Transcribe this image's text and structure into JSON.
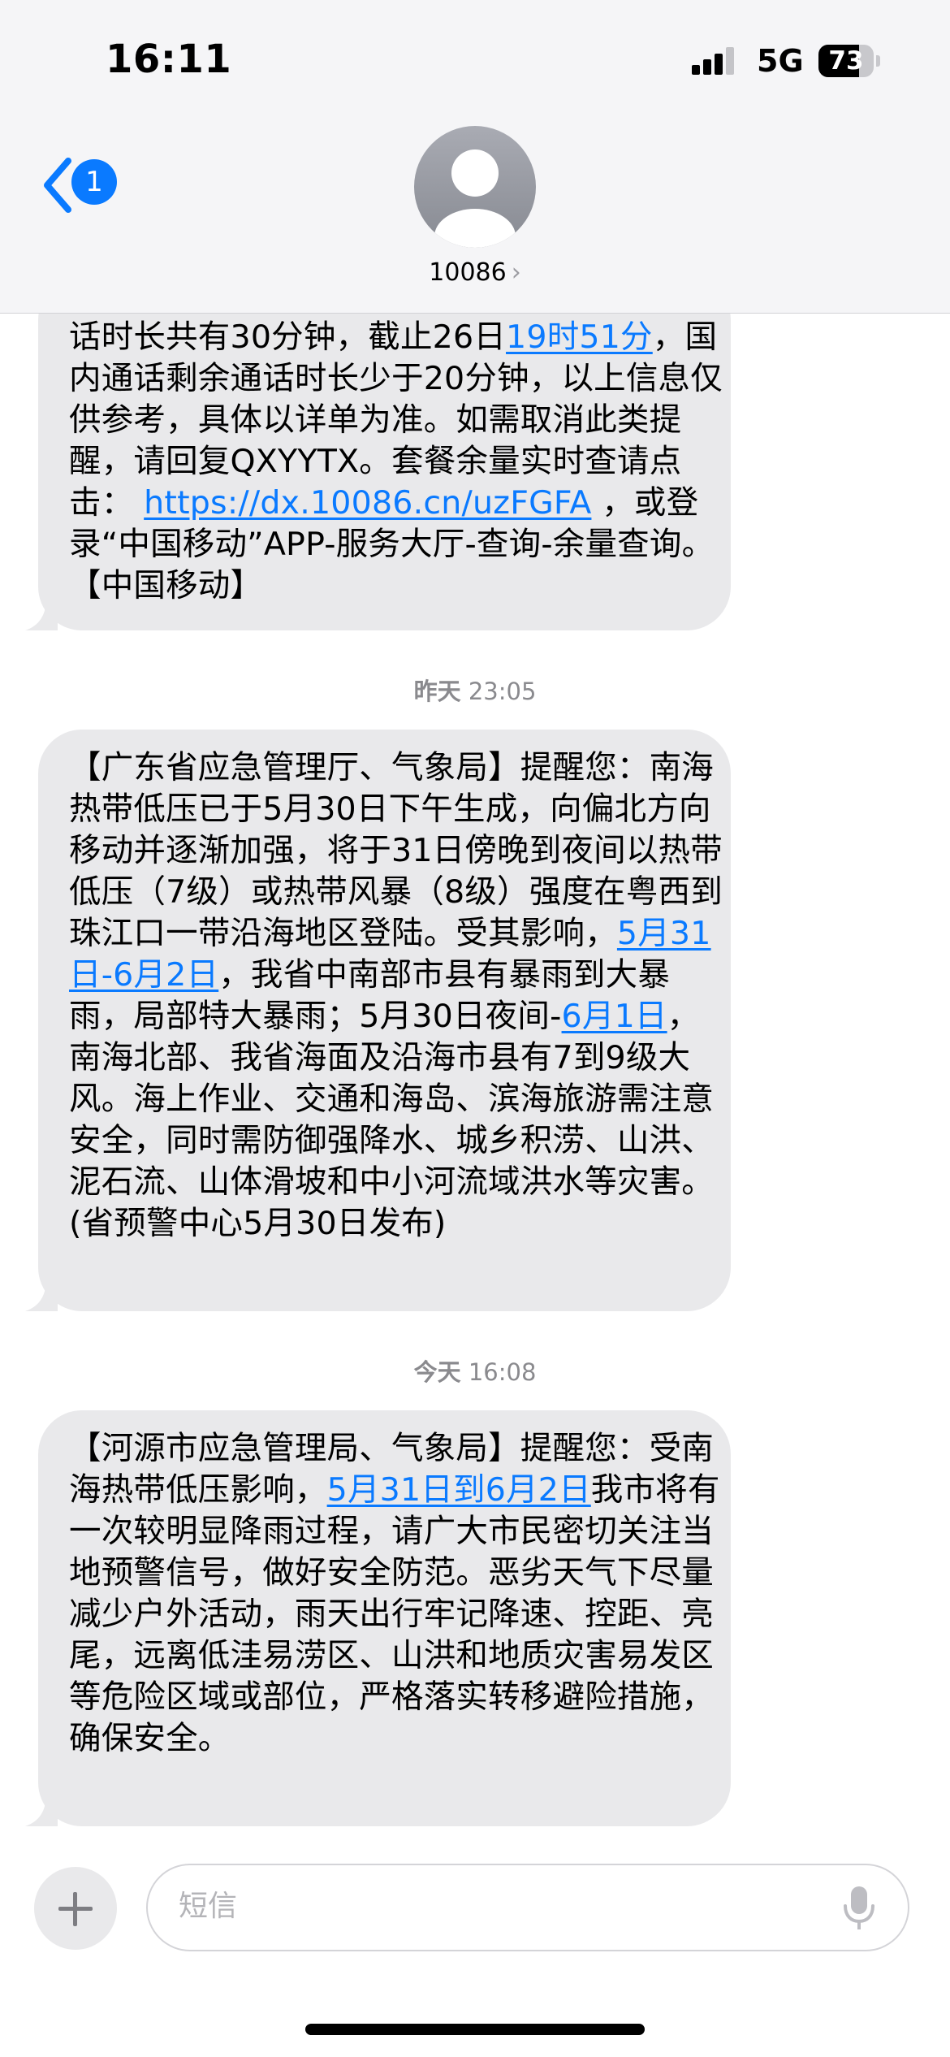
{
  "status_bar": {
    "time": "16:11",
    "network": "5G",
    "battery": "73"
  },
  "nav": {
    "back_count": "1",
    "contact_name": "10086",
    "contact_chevron": "›"
  },
  "thread": {
    "msg1": {
      "t1": "话时长共有30分钟，截止26日",
      "l1": "19时51分",
      "t2": "，国内通话剩余通话时长少于20分钟，以上信息仅供参考，具体以详单为准。如需取消此类提醒，请回复QXYYTX。套餐余量实时查请点击： ",
      "l2": "https://dx.10086.cn/uzFGFA",
      "t3": " ，或登录“中国移动”APP-服务大厅-查询-余量查询。【中国移动】"
    },
    "ts1": {
      "day": "昨天",
      "time": "23:05"
    },
    "msg2": {
      "t1": "【广东省应急管理厅、气象局】提醒您：南海热带低压已于5月30日下午生成，向偏北方向移动并逐渐加强，将于31日傍晚到夜间以热带低压（7级）或热带风暴（8级）强度在粤西到珠江口一带沿海地区登陆。受其影响，",
      "l1": "5月31日-6月2日",
      "t2": "，我省中南部市县有暴雨到大暴雨，局部特大暴雨；5月30日夜间-",
      "l2": "6月1日",
      "t3": "，南海北部、我省海面及沿海市县有7到9级大风。海上作业、交通和海岛、滨海旅游需注意安全，同时需防御强降水、城乡积涝、山洪、泥石流、山体滑坡和中小河流域洪水等灾害。(省预警中心5月30日发布)"
    },
    "ts2": {
      "day": "今天",
      "time": "16:08"
    },
    "msg3": {
      "t1": "【河源市应急管理局、气象局】提醒您：受南海热带低压影响，",
      "l1": "5月31日到6月2日",
      "t2": "我市将有一次较明显降雨过程，请广大市民密切关注当地预警信号，做好安全防范。恶劣天气下尽量减少户外活动，雨天出行牢记降速、控距、亮尾，远离低洼易涝区、山洪和地质灾害易发区等危险区域或部位，严格落实转移避险措施，确保安全。"
    }
  },
  "composer": {
    "placeholder": "短信"
  },
  "colors": {
    "link": "#0a7aff",
    "bubble": "#e9e9eb",
    "badge": "#0a7aff"
  }
}
